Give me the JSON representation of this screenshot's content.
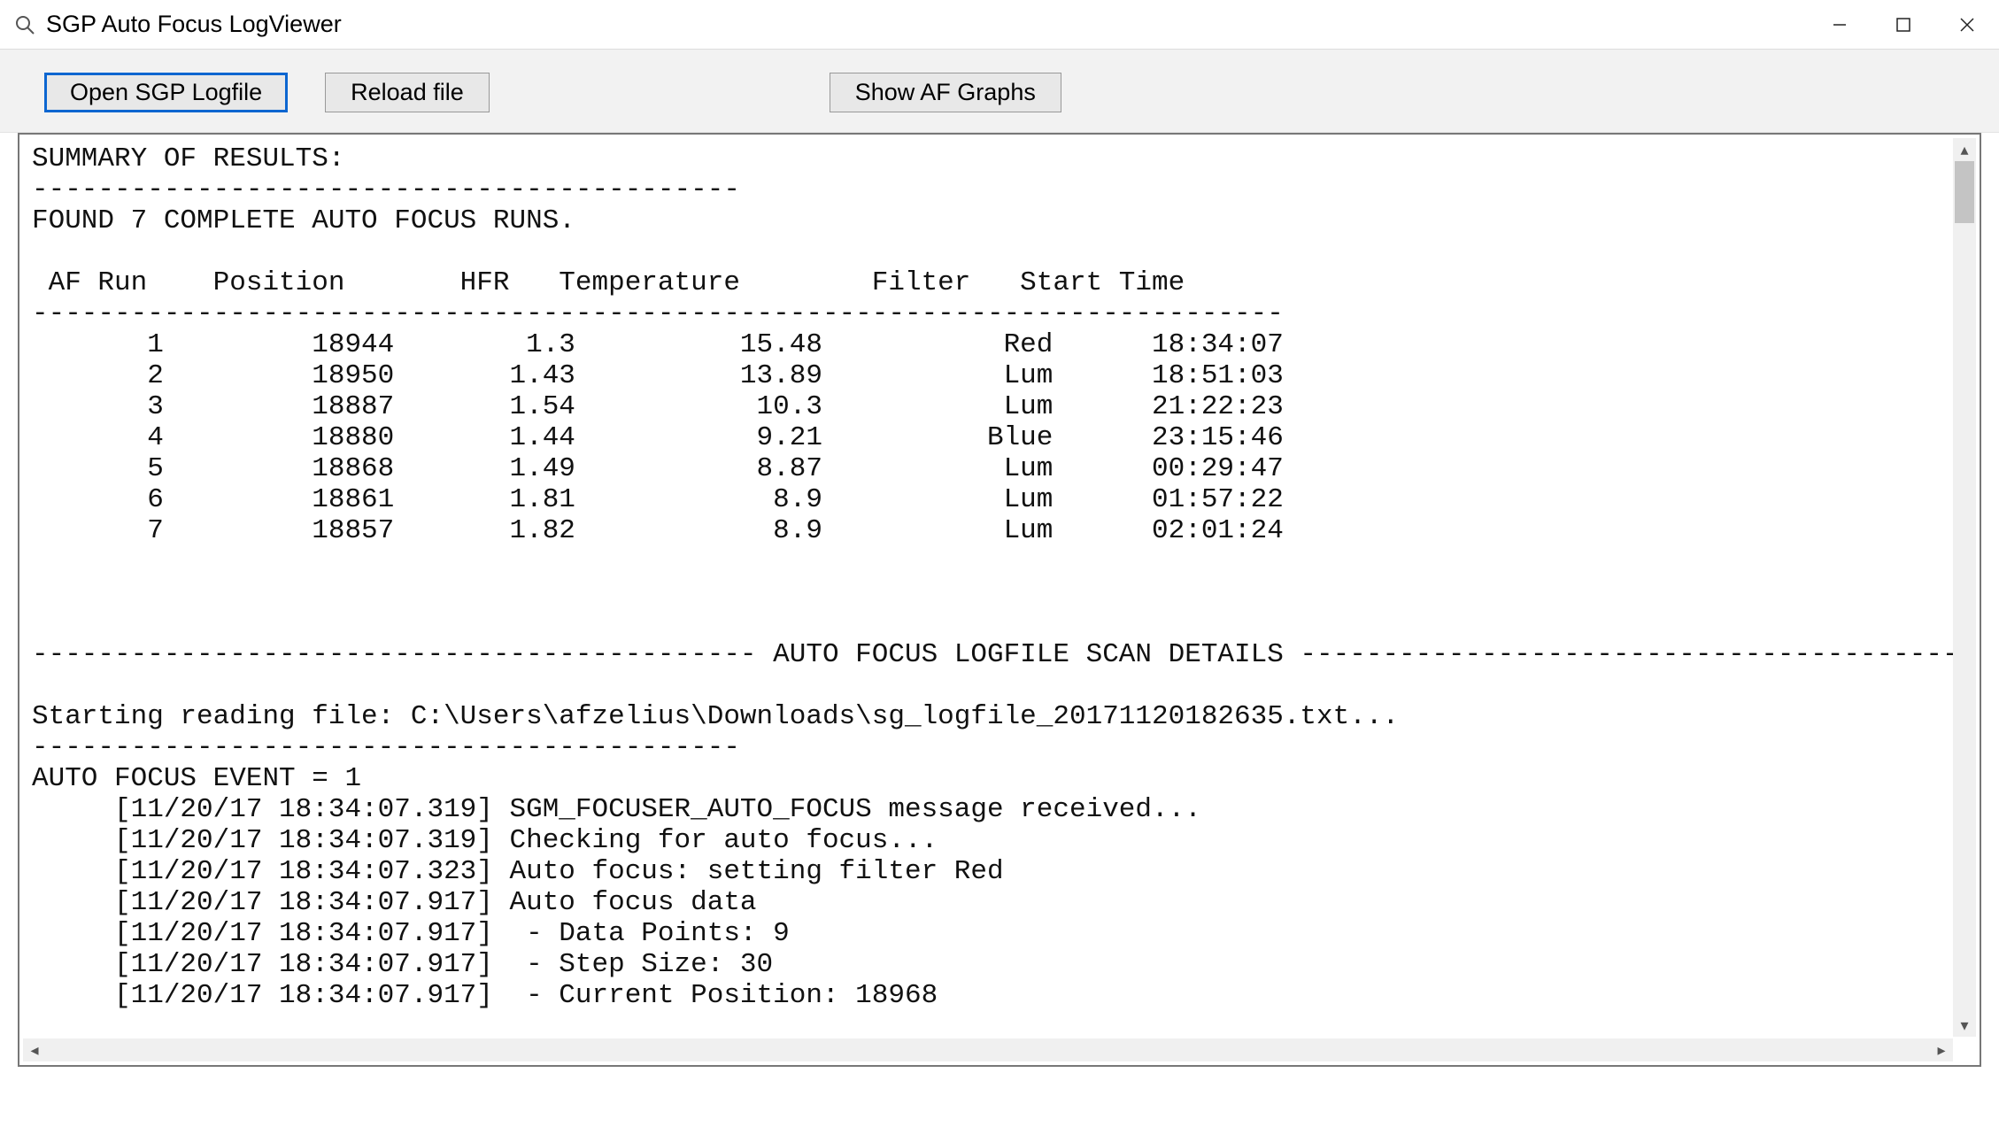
{
  "window": {
    "title": "SGP Auto Focus LogViewer"
  },
  "toolbar": {
    "open_label": "Open SGP Logfile",
    "reload_label": "Reload file",
    "graphs_label": "Show AF Graphs"
  },
  "summary": {
    "header": "SUMMARY OF RESULTS:",
    "found_line": "FOUND 7 COMPLETE AUTO FOCUS RUNS.",
    "columns": [
      "AF Run",
      "Position",
      "HFR",
      "Temperature",
      "Filter",
      "Start Time"
    ],
    "rows": [
      {
        "run": 1,
        "position": 18944,
        "hfr": "1.3",
        "temp": "15.48",
        "filter": "Red",
        "time": "18:34:07"
      },
      {
        "run": 2,
        "position": 18950,
        "hfr": "1.43",
        "temp": "13.89",
        "filter": "Lum",
        "time": "18:51:03"
      },
      {
        "run": 3,
        "position": 18887,
        "hfr": "1.54",
        "temp": "10.3",
        "filter": "Lum",
        "time": "21:22:23"
      },
      {
        "run": 4,
        "position": 18880,
        "hfr": "1.44",
        "temp": "9.21",
        "filter": "Blue",
        "time": "23:15:46"
      },
      {
        "run": 5,
        "position": 18868,
        "hfr": "1.49",
        "temp": "8.87",
        "filter": "Lum",
        "time": "00:29:47"
      },
      {
        "run": 6,
        "position": 18861,
        "hfr": "1.81",
        "temp": "8.9",
        "filter": "Lum",
        "time": "01:57:22"
      },
      {
        "run": 7,
        "position": 18857,
        "hfr": "1.82",
        "temp": "8.9",
        "filter": "Lum",
        "time": "02:01:24"
      }
    ]
  },
  "details": {
    "divider_title": "AUTO FOCUS LOGFILE SCAN DETAILS",
    "start_line": "Starting reading file: C:\\Users\\afzelius\\Downloads\\sg_logfile_20171120182635.txt...",
    "event_header": "AUTO FOCUS EVENT = 1",
    "lines": [
      "     [11/20/17 18:34:07.319] SGM_FOCUSER_AUTO_FOCUS message received...",
      "     [11/20/17 18:34:07.319] Checking for auto focus...",
      "     [11/20/17 18:34:07.323] Auto focus: setting filter Red",
      "     [11/20/17 18:34:07.917] Auto focus data",
      "     [11/20/17 18:34:07.917]  - Data Points: 9",
      "     [11/20/17 18:34:07.917]  - Step Size: 30",
      "     [11/20/17 18:34:07.917]  - Current Position: 18968"
    ]
  },
  "chart_data": {
    "type": "table",
    "title": "Auto Focus Run Summary",
    "columns": [
      "AF Run",
      "Position",
      "HFR",
      "Temperature",
      "Filter",
      "Start Time"
    ],
    "rows": [
      [
        1,
        18944,
        1.3,
        15.48,
        "Red",
        "18:34:07"
      ],
      [
        2,
        18950,
        1.43,
        13.89,
        "Lum",
        "18:51:03"
      ],
      [
        3,
        18887,
        1.54,
        10.3,
        "Lum",
        "21:22:23"
      ],
      [
        4,
        18880,
        1.44,
        9.21,
        "Blue",
        "23:15:46"
      ],
      [
        5,
        18868,
        1.49,
        8.87,
        "Lum",
        "00:29:47"
      ],
      [
        6,
        18861,
        1.81,
        8.9,
        "Lum",
        "01:57:22"
      ],
      [
        7,
        18857,
        1.82,
        8.9,
        "Lum",
        "02:01:24"
      ]
    ]
  }
}
